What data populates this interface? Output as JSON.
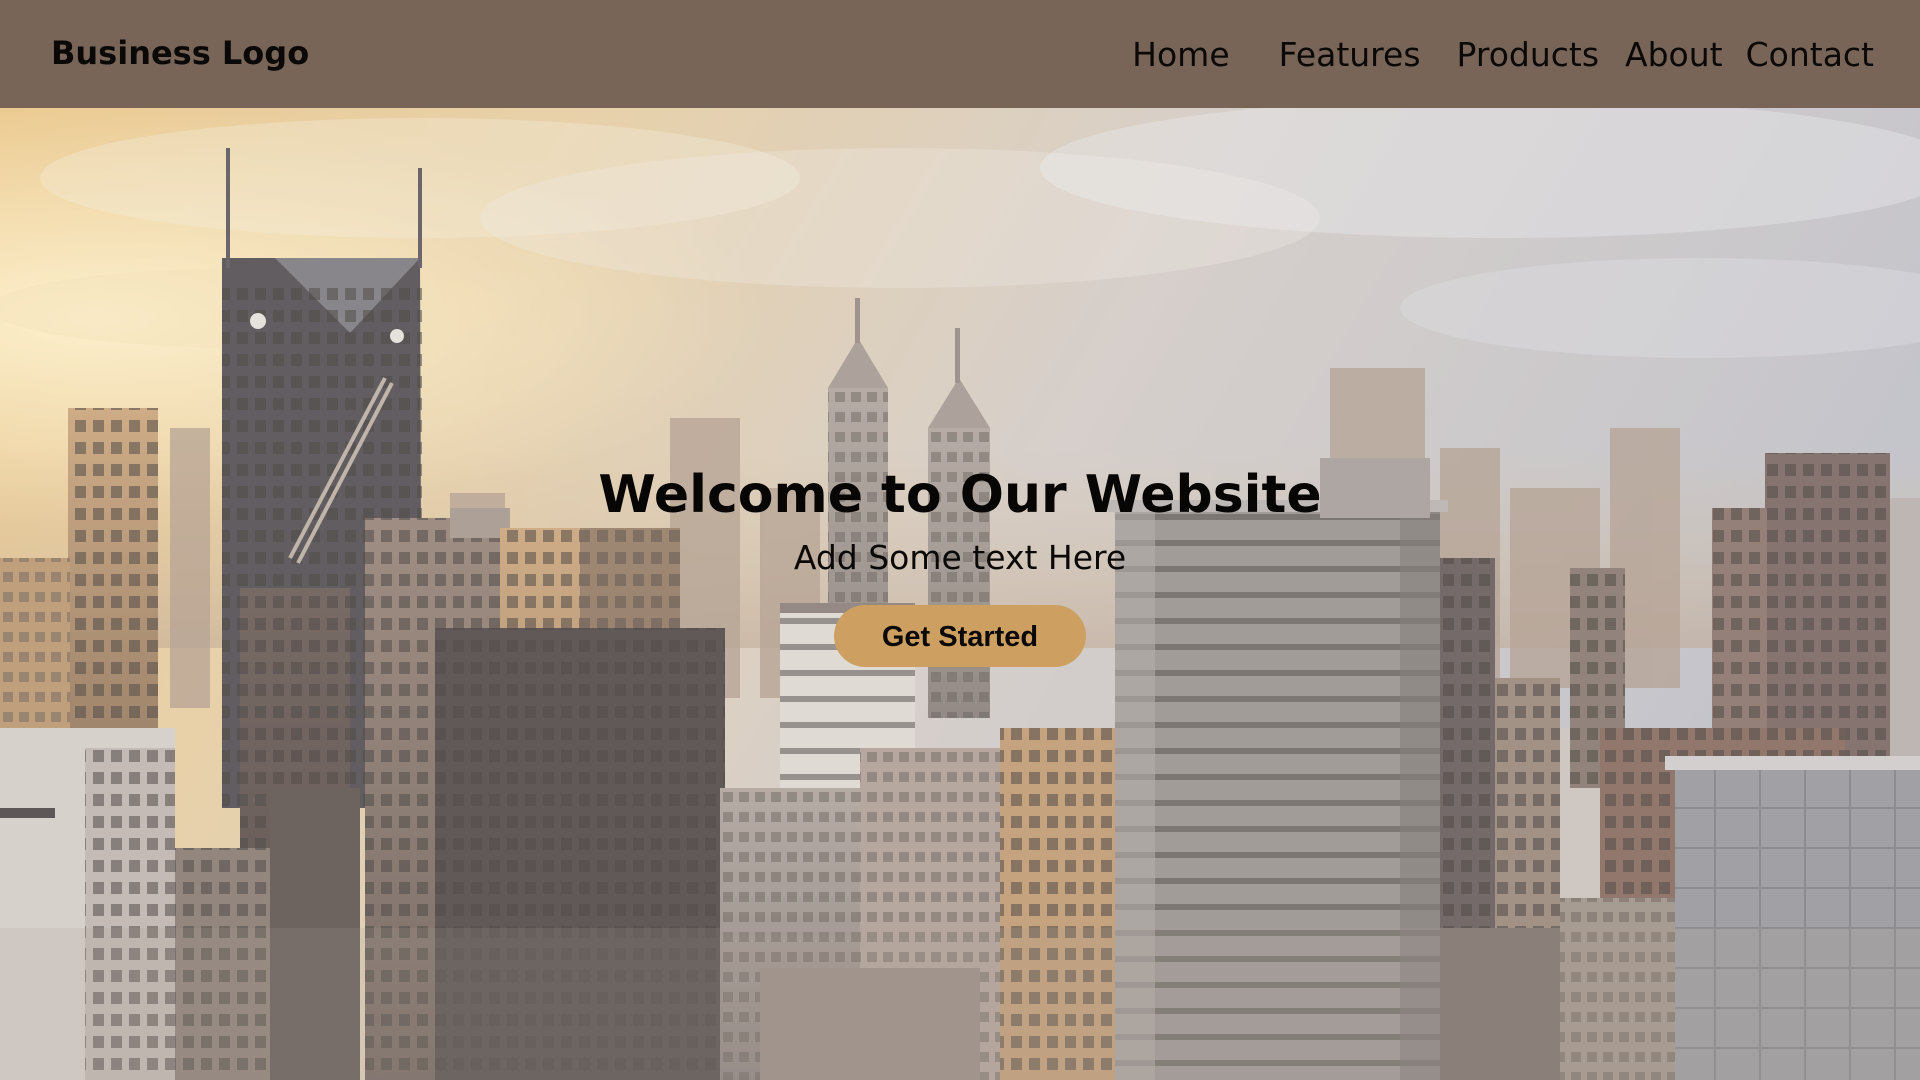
{
  "header": {
    "logo": "Business Logo",
    "nav": [
      {
        "label": "Home"
      },
      {
        "label": "Features"
      },
      {
        "label": "Products"
      },
      {
        "label": "About"
      },
      {
        "label": "Contact"
      }
    ]
  },
  "hero": {
    "title": "Welcome to Our Website",
    "subtitle": "Add Some text Here",
    "cta_label": "Get Started"
  },
  "colors": {
    "header_bg": "#786558",
    "cta_bg": "#cda062",
    "text": "#0b0907"
  }
}
